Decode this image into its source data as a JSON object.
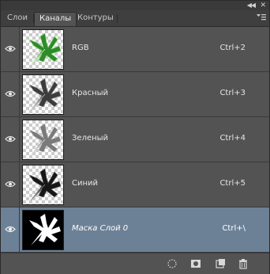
{
  "tabs": [
    {
      "label": "Слои",
      "active": false
    },
    {
      "label": "Каналы",
      "active": true
    },
    {
      "label": "Контуры",
      "active": false
    }
  ],
  "header": {
    "collapse_icon": "double-chevron-left-icon",
    "close_icon": "close-icon",
    "menu_icon": "panel-menu-icon"
  },
  "channels": [
    {
      "name": "RGB",
      "shortcut": "Ctrl+2",
      "visible": true,
      "thumb": "color",
      "selected": false
    },
    {
      "name": "Красный",
      "shortcut": "Ctrl+3",
      "visible": true,
      "thumb": "red",
      "selected": false
    },
    {
      "name": "Зеленый",
      "shortcut": "Ctrl+4",
      "visible": true,
      "thumb": "green",
      "selected": false
    },
    {
      "name": "Синий",
      "shortcut": "Ctrl+5",
      "visible": true,
      "thumb": "blue",
      "selected": false
    },
    {
      "name": "Маска Слой 0",
      "shortcut": "Ctrl+\\",
      "visible": true,
      "thumb": "mask",
      "selected": true
    }
  ],
  "footer_icons": [
    "load-selection-icon",
    "save-selection-mask-icon",
    "new-channel-icon",
    "trash-icon"
  ],
  "colors": {
    "panel_bg": "#535353",
    "selected_row": "#6d8196",
    "leaf_green": "#2f8f2a"
  }
}
